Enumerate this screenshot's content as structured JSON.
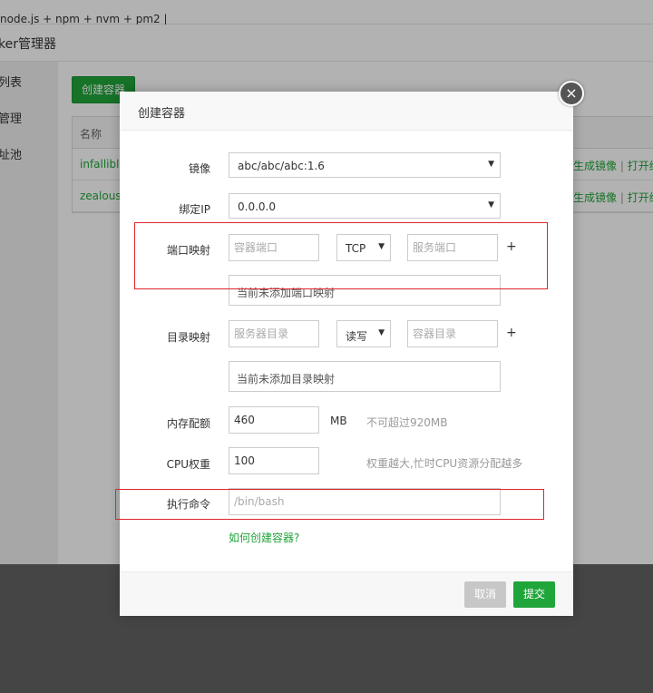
{
  "background": {
    "breadcrumb": "node.js + npm + nvm + pm2 |",
    "page_title": "ker管理器",
    "sidebar": [
      "列表",
      "管理",
      "址池"
    ],
    "create_button": "创建容器",
    "table": {
      "header_name": "名称",
      "rows": [
        {
          "name": "infallibl",
          "op1": "生成镜像",
          "sep": " | ",
          "op2": "打开终"
        },
        {
          "name": "zealous_",
          "op1": "生成镜像",
          "sep": " | ",
          "op2": "打开终"
        }
      ]
    }
  },
  "modal": {
    "title": "创建容器",
    "close_icon": "×",
    "image": {
      "label": "镜像",
      "value": "abc/abc/abc:1.6"
    },
    "bind_ip": {
      "label": "绑定IP",
      "value": "0.0.0.0"
    },
    "port_mapping": {
      "label": "端口映射",
      "container_port_placeholder": "容器端口",
      "protocol": "TCP",
      "host_port_placeholder": "服务端口",
      "add": "+",
      "empty_text": "当前未添加端口映射"
    },
    "dir_mapping": {
      "label": "目录映射",
      "host_dir_placeholder": "服务器目录",
      "mode": "读写",
      "container_dir_placeholder": "容器目录",
      "add": "+",
      "empty_text": "当前未添加目录映射"
    },
    "memory": {
      "label": "内存配额",
      "value": "460",
      "unit": "MB",
      "hint": "不可超过920MB"
    },
    "cpu": {
      "label": "CPU权重",
      "value": "100",
      "hint": "权重越大,忙时CPU资源分配越多"
    },
    "command": {
      "label": "执行命令",
      "placeholder": "/bin/bash"
    },
    "help_link": "如何创建容器?",
    "cancel": "取消",
    "submit": "提交"
  },
  "colors": {
    "accent": "#20a53a",
    "annotation": "#e0242a"
  }
}
